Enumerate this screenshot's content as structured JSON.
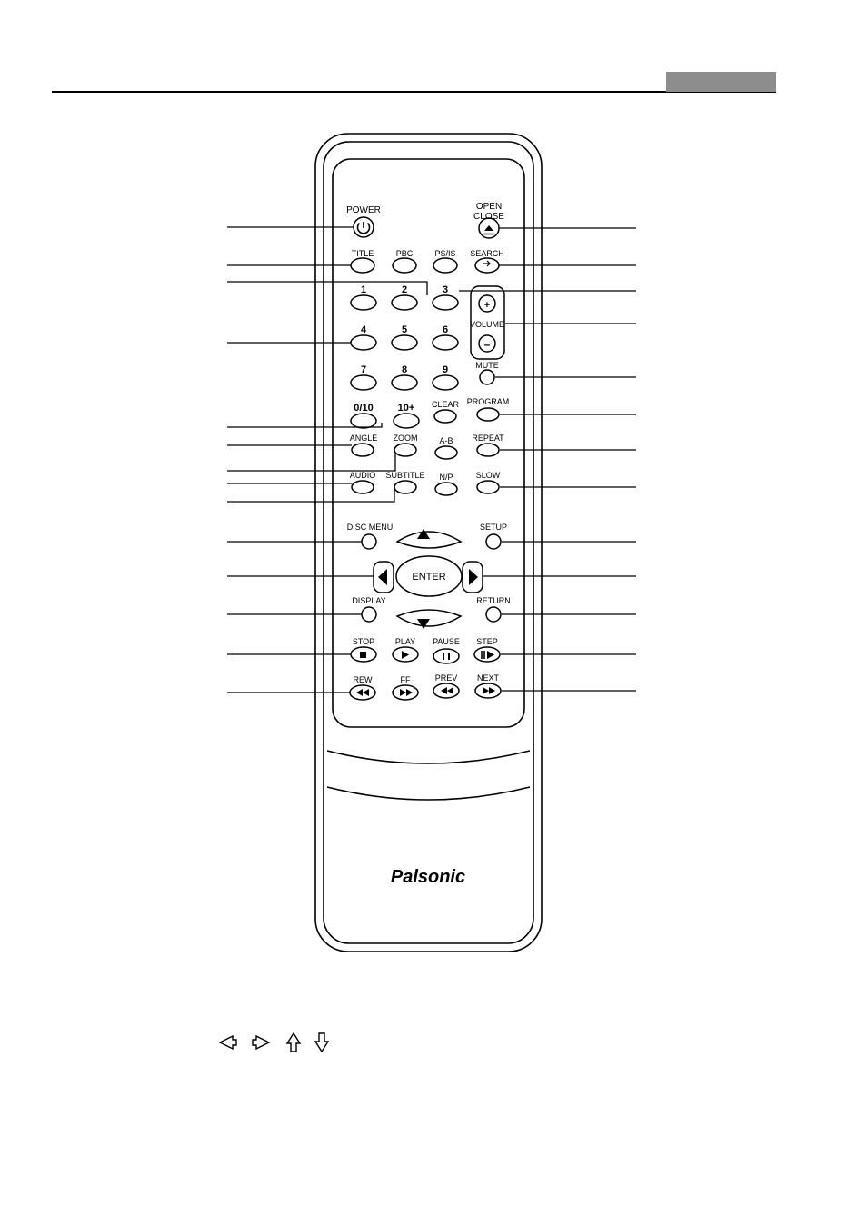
{
  "document": {
    "page_title": "",
    "header_block_color": "#8d8d8d",
    "rule_color": "#000000"
  },
  "remote": {
    "brand": "Palsonic",
    "buttons": {
      "power": "POWER",
      "open_close_line1": "OPEN",
      "open_close_line2": "CLOSE",
      "title": "TITLE",
      "pbc": "PBC",
      "psis": "PS/IS",
      "search": "SEARCH",
      "num1": "1",
      "num2": "2",
      "num3": "3",
      "num4": "4",
      "num5": "5",
      "num6": "6",
      "num7": "7",
      "num8": "8",
      "num9": "9",
      "num010": "0/10",
      "num10plus": "10+",
      "volume": "VOLUME",
      "volume_plus": "+",
      "volume_minus": "–",
      "mute": "MUTE",
      "clear": "CLEAR",
      "program": "PROGRAM",
      "angle": "ANGLE",
      "zoom": "ZOOM",
      "ab": "A-B",
      "repeat": "REPEAT",
      "audio": "AUDIO",
      "subtitle": "SUBTITLE",
      "np": "N/P",
      "slow": "SLOW",
      "disc_menu": "DISC MENU",
      "setup": "SETUP",
      "enter": "ENTER",
      "display": "DISPLAY",
      "return": "RETURN",
      "stop": "STOP",
      "play": "PLAY",
      "pause": "PAUSE",
      "step": "STEP",
      "rew": "REW",
      "ff": "FF",
      "prev": "PREV",
      "next": "NEXT"
    }
  },
  "legend": {
    "arrows": [
      "left-arrow",
      "right-arrow",
      "up-arrow",
      "down-arrow"
    ]
  }
}
